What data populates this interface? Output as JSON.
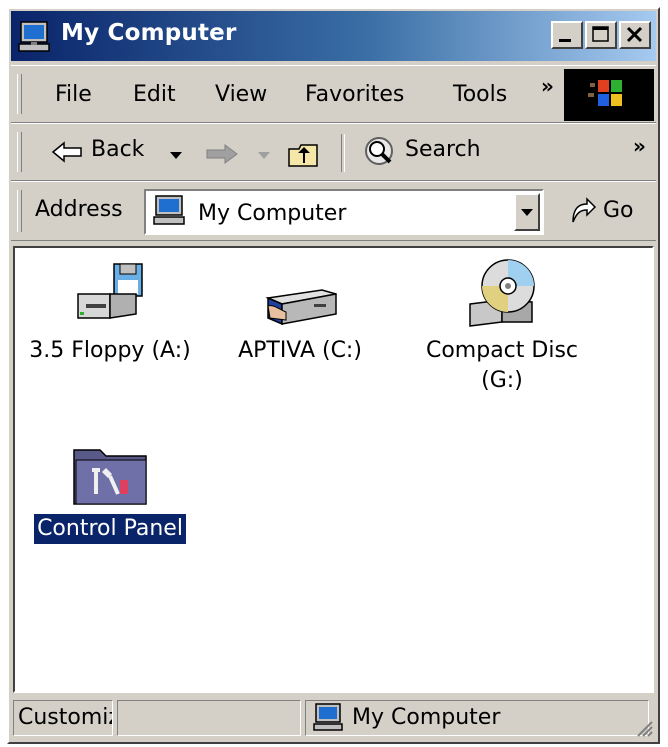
{
  "window": {
    "title": "My Computer"
  },
  "title_buttons": {
    "minimize": "minimize",
    "maximize": "maximize",
    "close": "close"
  },
  "menu": {
    "items": [
      "File",
      "Edit",
      "View",
      "Favorites",
      "Tools"
    ],
    "more": "»"
  },
  "toolbar": {
    "back": "Back",
    "search": "Search",
    "more": "»"
  },
  "address_bar": {
    "label": "Address",
    "value": "My Computer",
    "go": "Go"
  },
  "items": [
    {
      "label": "3.5 Floppy (A:)",
      "icon": "floppy-drive-icon"
    },
    {
      "label": "APTIVA (C:)",
      "icon": "hard-drive-icon"
    },
    {
      "label": "Compact Disc\n(G:)",
      "icon": "cd-drive-icon"
    },
    {
      "label": "Control Panel",
      "icon": "control-panel-icon",
      "selected": true
    }
  ],
  "status_bar": {
    "left": "Customiz",
    "right": "My Computer"
  },
  "colors": {
    "title_gradient_start": "#0a246a",
    "title_gradient_end": "#a6caf0",
    "face": "#d4d0c8",
    "selection": "#0a246a"
  }
}
